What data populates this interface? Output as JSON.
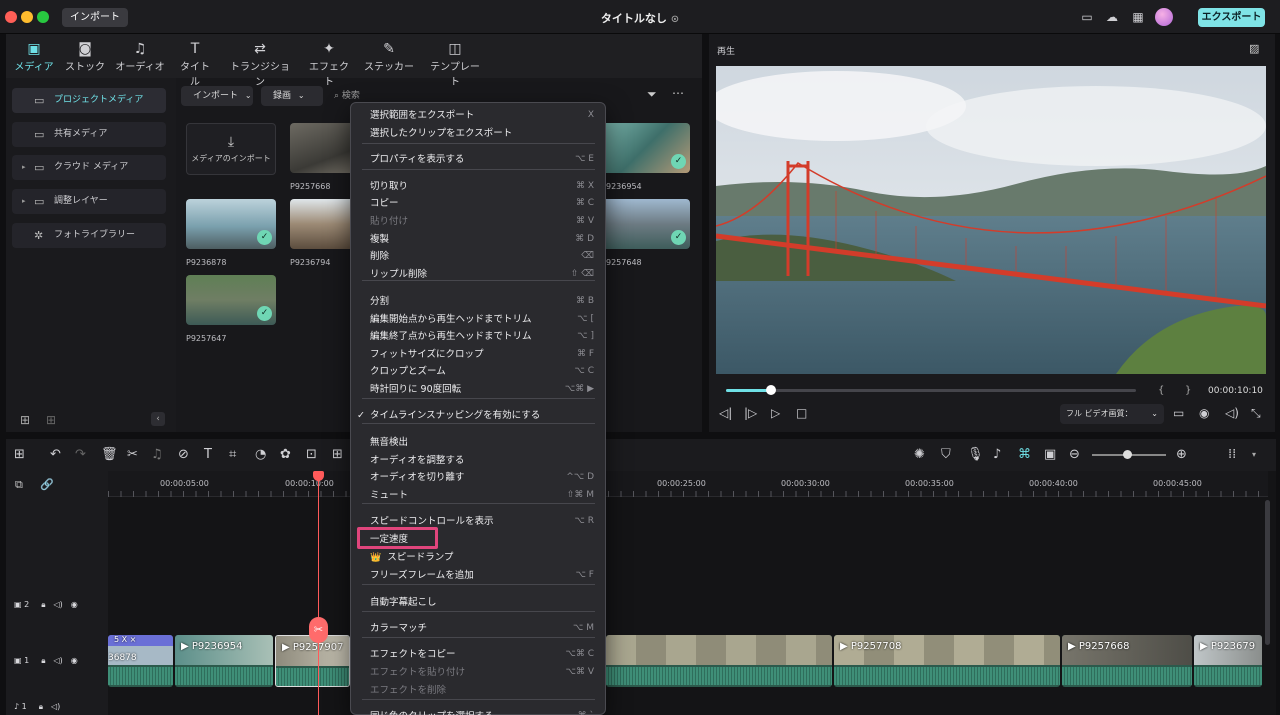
{
  "window": {
    "import_label": "インポート",
    "title": "タイトルなし",
    "export_label": "エクスポート"
  },
  "toolbar": [
    {
      "label": "メディア",
      "icon": "media-icon",
      "glyph": "▣"
    },
    {
      "label": "ストック",
      "icon": "stock-icon",
      "glyph": "◙"
    },
    {
      "label": "オーディオ",
      "icon": "music-icon",
      "glyph": "♫"
    },
    {
      "label": "タイトル",
      "icon": "title-icon",
      "glyph": "T"
    },
    {
      "label": "トランジション",
      "icon": "transition-icon",
      "glyph": "⇄"
    },
    {
      "label": "エフェクト",
      "icon": "effect-icon",
      "glyph": "✦"
    },
    {
      "label": "ステッカー",
      "icon": "sticker-icon",
      "glyph": "✎"
    },
    {
      "label": "テンプレート",
      "icon": "template-icon",
      "glyph": "◫"
    }
  ],
  "sidebar": [
    {
      "label": "プロジェクトメディア",
      "icon": "folder-icon"
    },
    {
      "label": "共有メディア",
      "icon": "folder-icon"
    },
    {
      "label": "クラウド メディア",
      "icon": "folder-icon"
    },
    {
      "label": "調整レイヤー",
      "icon": "folder-icon"
    },
    {
      "label": "フォトライブラリー",
      "icon": "aperture-icon"
    }
  ],
  "media": {
    "import_dropdown": "インポート",
    "record_dropdown": "録画",
    "search_placeholder": "検索",
    "import_tile": "メディアのインポート",
    "items": [
      "P9257668",
      "P9236954",
      "P9236878",
      "P9236794",
      "P9257648",
      "P9257647"
    ]
  },
  "player": {
    "title": "再生",
    "timecode": "00:00:10:10",
    "progress": 0.11,
    "quality": "フル ビデオ画質："
  },
  "timeline": {
    "ruler": [
      "00:00:05:00",
      "00:00:10:00",
      "00:00:25:00",
      "00:00:30:00",
      "00:00:35:00",
      "00:00:40:00",
      "00:00:45:00"
    ],
    "tracks": [
      "2",
      "1",
      "1"
    ],
    "clips": [
      "P9236954",
      "P9257907",
      "P9257708",
      "P9257668",
      "P923679",
      "36878"
    ],
    "clip_badge": "5 X ×"
  },
  "context_menu": [
    {
      "label": "選択範囲をエクスポート",
      "shortcut": "X",
      "disabled": false
    },
    {
      "label": "選択したクリップをエクスポート",
      "shortcut": "",
      "disabled": false
    },
    {
      "label": "プロパティを表示する",
      "shortcut": "⌥ E",
      "disabled": false
    },
    {
      "label": "切り取り",
      "shortcut": "⌘ X",
      "disabled": false
    },
    {
      "label": "コピー",
      "shortcut": "⌘ C",
      "disabled": false
    },
    {
      "label": "貼り付け",
      "shortcut": "⌘ V",
      "disabled": true
    },
    {
      "label": "複製",
      "shortcut": "⌘ D",
      "disabled": false
    },
    {
      "label": "削除",
      "shortcut": "⌫",
      "disabled": false
    },
    {
      "label": "リップル削除",
      "shortcut": "⇧ ⌫",
      "disabled": false
    },
    {
      "label": "分割",
      "shortcut": "⌘ B",
      "disabled": false
    },
    {
      "label": "編集開始点から再生ヘッドまでトリム",
      "shortcut": "⌥ [",
      "disabled": false
    },
    {
      "label": "編集終了点から再生ヘッドまでトリム",
      "shortcut": "⌥ ]",
      "disabled": false
    },
    {
      "label": "フィットサイズにクロップ",
      "shortcut": "⌘ F",
      "disabled": false
    },
    {
      "label": "クロップとズーム",
      "shortcut": "⌥ C",
      "disabled": false
    },
    {
      "label": "時計回りに 90度回転",
      "shortcut": "⌥⌘ ▶",
      "disabled": false
    },
    {
      "label": "タイムラインスナッピングを有効にする",
      "shortcut": "",
      "disabled": false,
      "checked": "✓"
    },
    {
      "label": "無音検出",
      "shortcut": "",
      "disabled": false
    },
    {
      "label": "オーディオを調整する",
      "shortcut": "",
      "disabled": false
    },
    {
      "label": "オーディオを切り離す",
      "shortcut": "^⌥ D",
      "disabled": false
    },
    {
      "label": "ミュート",
      "shortcut": "⇧⌘ M",
      "disabled": false
    },
    {
      "label": "スピードコントロールを表示",
      "shortcut": "⌥ R",
      "disabled": false
    },
    {
      "label": "一定速度",
      "shortcut": "",
      "disabled": false
    },
    {
      "label": "スピードランプ",
      "shortcut": "",
      "disabled": false,
      "crown": "👑"
    },
    {
      "label": "フリーズフレームを追加",
      "shortcut": "⌥ F",
      "disabled": false
    },
    {
      "label": "自動字幕起こし",
      "shortcut": "",
      "disabled": false
    },
    {
      "label": "カラーマッチ",
      "shortcut": "⌥ M",
      "disabled": false
    },
    {
      "label": "エフェクトをコピー",
      "shortcut": "⌥⌘ C",
      "disabled": false
    },
    {
      "label": "エフェクトを貼り付け",
      "shortcut": "⌥⌘ V",
      "disabled": true
    },
    {
      "label": "エフェクトを削除",
      "shortcut": "",
      "disabled": true
    },
    {
      "label": "同じ色のクリップを選択する",
      "shortcut": "⌘ `",
      "disabled": false
    }
  ]
}
